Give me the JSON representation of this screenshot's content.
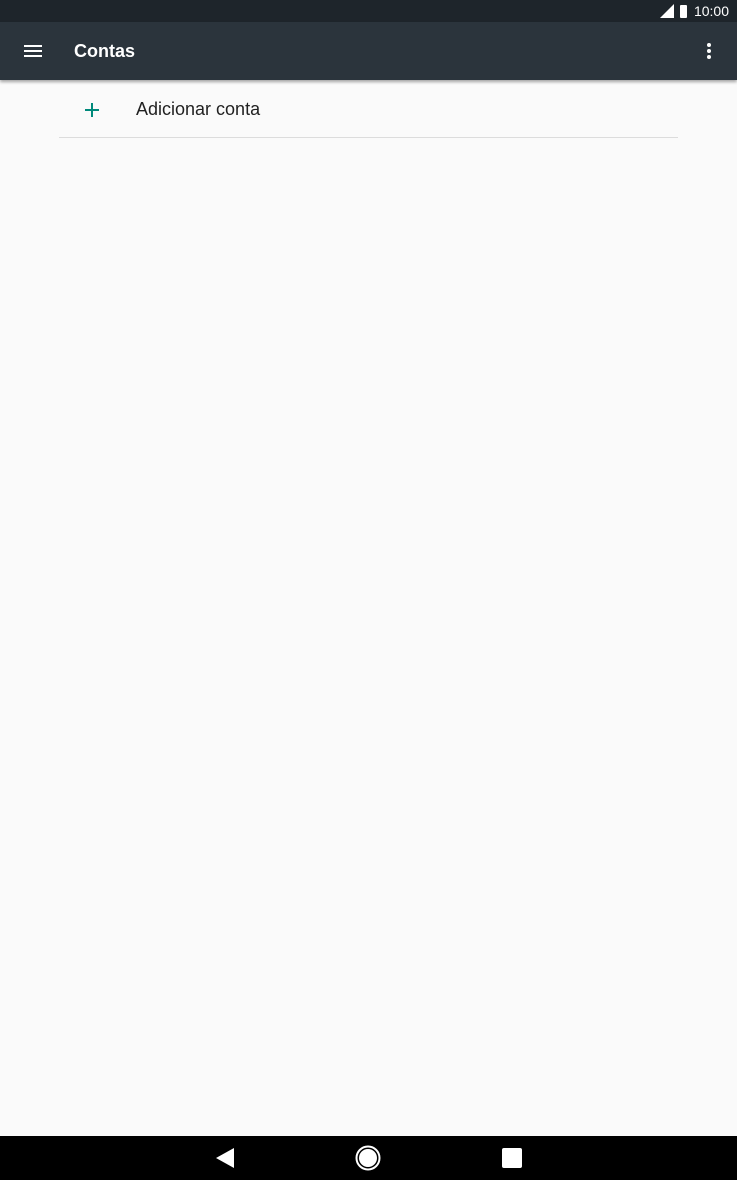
{
  "status_bar": {
    "time": "10:00",
    "icons": [
      "signal-icon",
      "battery-icon"
    ]
  },
  "toolbar": {
    "title": "Contas",
    "menu_icon": "menu-icon",
    "overflow_icon": "more-vert-icon",
    "background_color": "#2b343c"
  },
  "list": {
    "items": [
      {
        "label": "Adicionar conta",
        "icon": "add-icon",
        "icon_color": "#00897b"
      }
    ]
  },
  "nav_bar": {
    "buttons": [
      "back-icon",
      "home-icon",
      "recents-icon"
    ]
  }
}
